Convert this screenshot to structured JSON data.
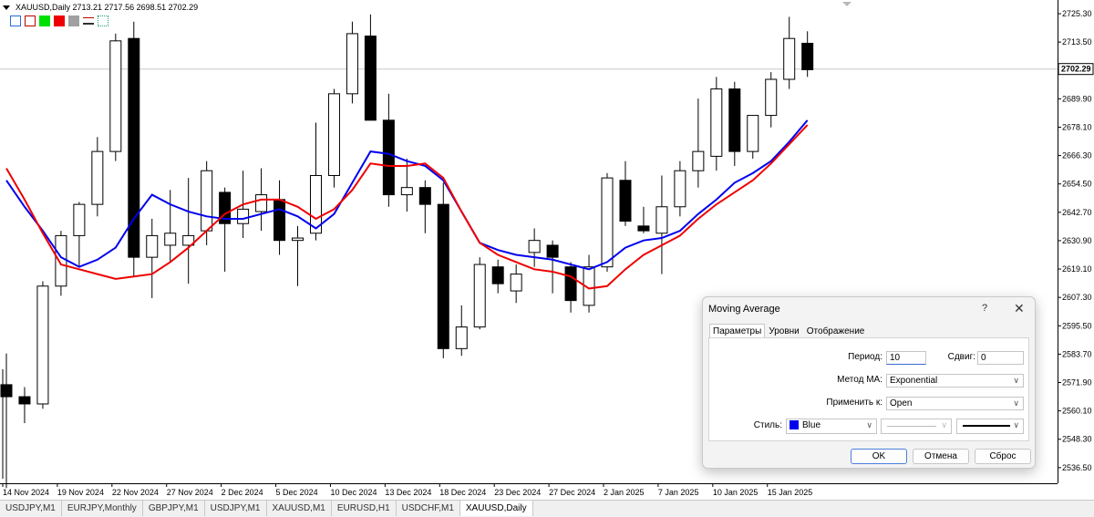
{
  "chart": {
    "symbol_line": "XAUUSD,Daily  2713.21 2717.56 2698.51 2702.29",
    "current_price": 2702.29,
    "current_price_label": "2702.29",
    "y_axis": {
      "min": 2530.0,
      "max": 2731.0,
      "ticks": [
        "2725.30",
        "2713.50",
        "2701.70",
        "2689.90",
        "2678.10",
        "2666.30",
        "2654.50",
        "2642.70",
        "2630.90",
        "2619.10",
        "2607.30",
        "2595.50",
        "2583.70",
        "2571.90",
        "2560.10",
        "2548.30",
        "2536.50"
      ]
    },
    "x_labels": [
      {
        "text": "14 Nov 2024",
        "i": 0
      },
      {
        "text": "19 Nov 2024",
        "i": 3
      },
      {
        "text": "22 Nov 2024",
        "i": 6
      },
      {
        "text": "27 Nov 2024",
        "i": 9
      },
      {
        "text": "2 Dec 2024",
        "i": 12
      },
      {
        "text": "5 Dec 2024",
        "i": 15
      },
      {
        "text": "10 Dec 2024",
        "i": 18
      },
      {
        "text": "13 Dec 2024",
        "i": 21
      },
      {
        "text": "18 Dec 2024",
        "i": 24
      },
      {
        "text": "23 Dec 2024",
        "i": 27
      },
      {
        "text": "27 Dec 2024",
        "i": 30
      },
      {
        "text": "2 Jan 2025",
        "i": 33
      },
      {
        "text": "7 Jan 2025",
        "i": 36
      },
      {
        "text": "10 Jan 2025",
        "i": 39
      },
      {
        "text": "15 Jan 2025",
        "i": 42
      }
    ],
    "colors": {
      "ma_blue": "#0000ee",
      "ma_red": "#ee0000",
      "bull": "#ffffff",
      "bear": "#000000"
    }
  },
  "chart_data": {
    "type": "candlestick",
    "candles": [
      {
        "o": 2571,
        "h": 2584,
        "l": 2528,
        "c": 2566
      },
      {
        "o": 2566,
        "h": 2570,
        "l": 2555,
        "c": 2563
      },
      {
        "o": 2563,
        "h": 2614,
        "l": 2561,
        "c": 2612
      },
      {
        "o": 2612,
        "h": 2635,
        "l": 2608,
        "c": 2633
      },
      {
        "o": 2633,
        "h": 2647,
        "l": 2620,
        "c": 2646
      },
      {
        "o": 2646,
        "h": 2674,
        "l": 2641,
        "c": 2668
      },
      {
        "o": 2668,
        "h": 2717,
        "l": 2664,
        "c": 2714
      },
      {
        "o": 2715,
        "h": 2722,
        "l": 2616,
        "c": 2624
      },
      {
        "o": 2624,
        "h": 2640,
        "l": 2607,
        "c": 2633
      },
      {
        "o": 2629,
        "h": 2652,
        "l": 2622,
        "c": 2634
      },
      {
        "o": 2629,
        "h": 2657,
        "l": 2613,
        "c": 2633
      },
      {
        "o": 2635,
        "h": 2664,
        "l": 2629,
        "c": 2660
      },
      {
        "o": 2651,
        "h": 2653,
        "l": 2618,
        "c": 2638
      },
      {
        "o": 2638,
        "h": 2660,
        "l": 2632,
        "c": 2644
      },
      {
        "o": 2643,
        "h": 2661,
        "l": 2635,
        "c": 2650
      },
      {
        "o": 2648,
        "h": 2656,
        "l": 2625,
        "c": 2631
      },
      {
        "o": 2631,
        "h": 2637,
        "l": 2612,
        "c": 2632
      },
      {
        "o": 2634,
        "h": 2680,
        "l": 2631,
        "c": 2658
      },
      {
        "o": 2658,
        "h": 2694,
        "l": 2653,
        "c": 2692
      },
      {
        "o": 2692,
        "h": 2722,
        "l": 2688,
        "c": 2717
      },
      {
        "o": 2716,
        "h": 2725,
        "l": 2681,
        "c": 2681
      },
      {
        "o": 2681,
        "h": 2692,
        "l": 2645,
        "c": 2650
      },
      {
        "o": 2650,
        "h": 2665,
        "l": 2643,
        "c": 2653
      },
      {
        "o": 2653,
        "h": 2656,
        "l": 2634,
        "c": 2646
      },
      {
        "o": 2646,
        "h": 2655,
        "l": 2582,
        "c": 2586
      },
      {
        "o": 2586,
        "h": 2604,
        "l": 2583,
        "c": 2595
      },
      {
        "o": 2595,
        "h": 2624,
        "l": 2594,
        "c": 2621
      },
      {
        "o": 2620,
        "h": 2623,
        "l": 2609,
        "c": 2613
      },
      {
        "o": 2610,
        "h": 2621,
        "l": 2605,
        "c": 2617
      },
      {
        "o": 2626,
        "h": 2636,
        "l": 2620,
        "c": 2631
      },
      {
        "o": 2629,
        "h": 2631,
        "l": 2609,
        "c": 2624
      },
      {
        "o": 2620,
        "h": 2622,
        "l": 2601,
        "c": 2606
      },
      {
        "o": 2604,
        "h": 2625,
        "l": 2601,
        "c": 2620
      },
      {
        "o": 2620,
        "h": 2659,
        "l": 2618,
        "c": 2657
      },
      {
        "o": 2656,
        "h": 2664,
        "l": 2637,
        "c": 2639
      },
      {
        "o": 2637,
        "h": 2645,
        "l": 2634,
        "c": 2635
      },
      {
        "o": 2634,
        "h": 2658,
        "l": 2617,
        "c": 2645
      },
      {
        "o": 2645,
        "h": 2664,
        "l": 2641,
        "c": 2660
      },
      {
        "o": 2660,
        "h": 2690,
        "l": 2653,
        "c": 2668
      },
      {
        "o": 2666,
        "h": 2699,
        "l": 2660,
        "c": 2694
      },
      {
        "o": 2694,
        "h": 2697,
        "l": 2662,
        "c": 2668
      },
      {
        "o": 2668,
        "h": 2683,
        "l": 2665,
        "c": 2683
      },
      {
        "o": 2683,
        "h": 2701,
        "l": 2678,
        "c": 2698
      },
      {
        "o": 2698,
        "h": 2724,
        "l": 2694,
        "c": 2715
      },
      {
        "o": 2713,
        "h": 2718,
        "l": 2699,
        "c": 2702
      }
    ],
    "series": [
      {
        "color": "#0000ee",
        "values": [
          2656,
          2645,
          2635,
          2624,
          2620,
          2623,
          2628,
          2640,
          2650,
          2646,
          2643,
          2641,
          2640,
          2640,
          2642,
          2644,
          2641,
          2636,
          2642,
          2655,
          2668,
          2667,
          2664,
          2662,
          2656,
          2643,
          2630,
          2627,
          2625,
          2624,
          2623,
          2621,
          2619,
          2622,
          2628,
          2631,
          2632,
          2635,
          2642,
          2648,
          2655,
          2659,
          2664,
          2672,
          2681
        ]
      },
      {
        "color": "#ee0000",
        "values": [
          2661,
          2648,
          2634,
          2621,
          2619,
          2617,
          2615,
          2616,
          2617,
          2622,
          2628,
          2635,
          2642,
          2646,
          2648,
          2648,
          2645,
          2640,
          2644,
          2652,
          2663,
          2662,
          2662,
          2663,
          2657,
          2643,
          2630,
          2625,
          2622,
          2619,
          2618,
          2616,
          2611,
          2612,
          2619,
          2625,
          2629,
          2633,
          2640,
          2646,
          2651,
          2656,
          2663,
          2671,
          2679
        ]
      }
    ],
    "ylim": [
      2530.0,
      2731.0
    ]
  },
  "tabs": [
    "USDJPY,M1",
    "EURJPY,Monthly",
    "GBPJPY,M1",
    "USDJPY,M1",
    "XAUUSD,M1",
    "EURUSD,H1",
    "USDCHF,M1",
    "XAUUSD,Daily"
  ],
  "active_tab": 7,
  "dialog": {
    "title": "Moving Average",
    "help": "?",
    "close": "✕",
    "tabs": [
      "Параметры",
      "Уровни",
      "Отображение"
    ],
    "period_label": "Период:",
    "period_value": "10",
    "shift_label": "Сдвиг:",
    "shift_value": "0",
    "method_label": "Метод МА:",
    "method_value": "Exponential",
    "apply_label": "Применить к:",
    "apply_value": "Open",
    "style_label": "Стиль:",
    "color_name": "Blue",
    "color_hex": "#0000ee",
    "ok": "OK",
    "cancel": "Отмена",
    "reset": "Сброс"
  }
}
